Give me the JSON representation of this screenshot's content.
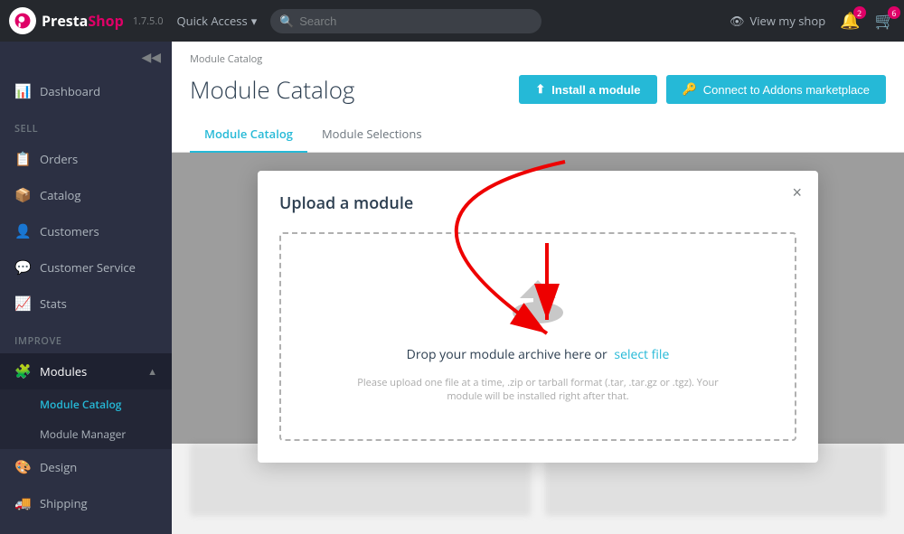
{
  "brand": {
    "presta": "Presta",
    "shop": "Shop",
    "version": "1.7.5.0"
  },
  "navbar": {
    "quick_access_label": "Quick Access",
    "search_placeholder": "Search",
    "view_my_shop": "View my shop",
    "notifications_count": "2",
    "cart_count": "6"
  },
  "sidebar": {
    "dashboard_label": "Dashboard",
    "sell_section": "SELL",
    "orders_label": "Orders",
    "catalog_label": "Catalog",
    "customers_label": "Customers",
    "customer_service_label": "Customer Service",
    "stats_label": "Stats",
    "improve_section": "IMPROVE",
    "modules_label": "Modules",
    "module_catalog_label": "Module Catalog",
    "module_manager_label": "Module Manager",
    "design_label": "Design",
    "shipping_label": "Shipping"
  },
  "page": {
    "breadcrumb": "Module Catalog",
    "title": "Module Catalog",
    "install_btn": "Install a module",
    "addons_btn": "Connect to Addons marketplace",
    "tab_catalog": "Module Catalog",
    "tab_selections": "Module Selections"
  },
  "modal": {
    "title": "Upload a module",
    "close": "×",
    "upload_text": "Drop your module archive here or",
    "upload_link": "select file",
    "upload_hint": "Please upload one file at a time, .zip or tarball format (.tar, .tar.gz or .tgz). Your module will be installed right after that."
  }
}
